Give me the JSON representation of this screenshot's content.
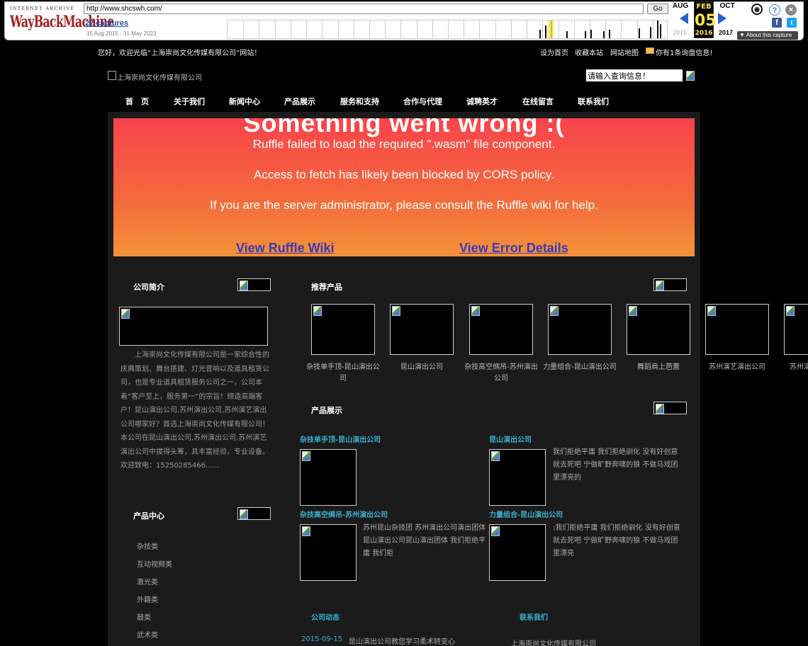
{
  "wayback": {
    "logo_top": "INTERNET ARCHIVE",
    "logo": "WayBackMachine",
    "url": "http://www.shcswh.com/",
    "go_label": "Go",
    "captures": "22 captures",
    "range": "15 Aug 2015 - 31 May 2023",
    "month_prev": "AUG",
    "month_cur": "FEB",
    "day_cur": "05",
    "month_next": "OCT",
    "year_prev": "2015",
    "year_cur": "2016",
    "year_next": "2017",
    "about_label": "▼ About this capture",
    "icons": [
      "account-icon",
      "help-icon",
      "close-icon",
      "facebook-icon",
      "twitter-icon"
    ]
  },
  "topbar": {
    "welcome": "您好，欢迎光临“上海崇尚文化传媒有限公司”网站！",
    "links": [
      "设为首页",
      "收藏本站",
      "网站地图"
    ],
    "messages": "你有1条询盘信息!"
  },
  "header": {
    "logo_alt": "上海崇尚文化传媒有限公司",
    "search_value": "请输入查询信息！"
  },
  "nav": [
    "首　页",
    "关于我们",
    "新闻中心",
    "产品展示",
    "服务和支持",
    "合作与代理",
    "诚聘英才",
    "在线留言",
    "联系我们"
  ],
  "ruffle": {
    "heading": "Something went wrong :(",
    "line1": "Ruffle failed to load the required \".wasm\" file component.",
    "line2": "Access to fetch has likely been blocked by CORS policy.",
    "line3": "If you are the server administrator, please consult the Ruffle wiki for help.",
    "wiki_link": "View Ruffle Wiki",
    "error_link": "View Error Details"
  },
  "sidebar": {
    "intro_title": "公司简介",
    "intro_text": "　　上海崇尚文化传媒有限公司是一家综合性的庆典策划、舞台搭建、灯光音响以及道具租赁公司，也是专业道具租赁服务公司之一，公司本着“客户至上，服务第一”的宗旨！缔造高端客户！昆山演出公司,苏州演出公司,苏州演艺演出公司哪家好？首选上海崇尚文化传媒有限公司！本公司在昆山演出公司,苏州演出公司,苏州演艺演出公司中拔得头筹，具丰富经验，专业设备。欢迎致电：15250285466......",
    "products_title": "产品中心",
    "categories": [
      "杂技类",
      "互动视频类",
      "激光类",
      "外籍类",
      "鼓类",
      "武术类"
    ]
  },
  "recommend": {
    "title": "推荐产品",
    "items": [
      "杂技单手顶-昆山演出公司",
      "昆山演出公司",
      "杂技高空绸吊-苏州演出公司",
      "力量组合-昆山演出公司",
      "舞蹈肩上芭蕾",
      "苏州演艺演出公司",
      "苏州演"
    ]
  },
  "showcase": {
    "title": "产品展示",
    "items": [
      {
        "title": "杂技单手顶-昆山演出公司",
        "desc": ""
      },
      {
        "title": "昆山演出公司",
        "desc": "我们拒绝平庸 我们拒绝驯化 没有好创意就去死吧 宁做旷野奔啸的狼 不做马戏团里漂亮的"
      },
      {
        "title": "杂技高空绸吊-苏州演出公司",
        "desc": "苏州昆山杂技团 苏州演出公司演出团体 昆山演出公司昆山演出团体 我们拒绝平庸 我们拒"
      },
      {
        "title": "力量组合-昆山演出公司",
        "desc": ":我们拒绝平庸 我们拒绝驯化 没有好创意就去死吧 宁做旷野奔啸的狼 不做马戏团里漂亮"
      }
    ]
  },
  "news": {
    "title": "公司动态",
    "date": "2015-09-15",
    "headline": "昆山演出公司教您学习柔术转变心"
  },
  "contact": {
    "title": "联系我们",
    "company": "上海崇尚文化传媒有限公司"
  },
  "colors": {
    "ruffle_top": "#f8434c",
    "ruffle_bottom": "#f4913a",
    "accent_link": "#3ab0d0",
    "wayback_red": "#a02121"
  }
}
